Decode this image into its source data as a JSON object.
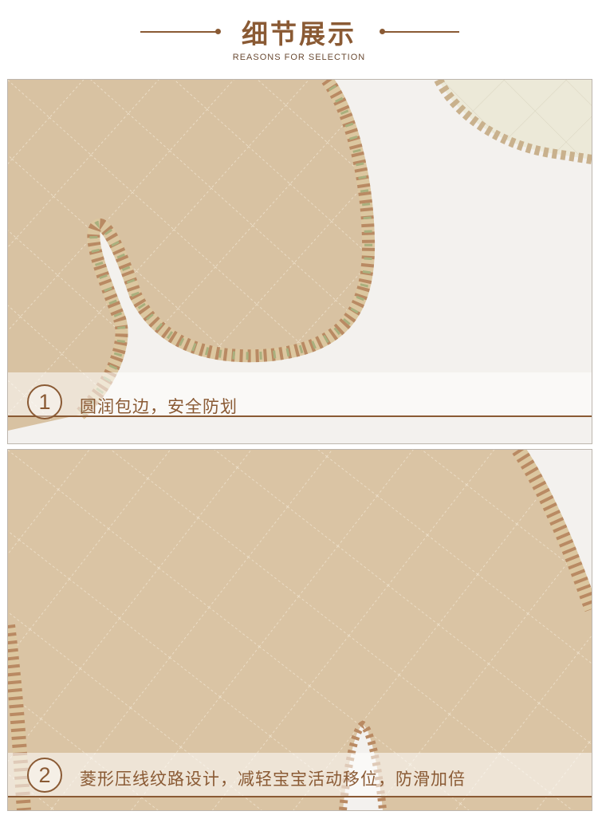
{
  "header": {
    "title": "细节展示",
    "subtitle": "REASONS FOR SELECTION"
  },
  "colors": {
    "accent": "#8a5a34",
    "fabric": "#d9c3a3",
    "stitch": "#efe3cf"
  },
  "features": [
    {
      "number": "1",
      "text": "圆润包边，安全防划"
    },
    {
      "number": "2",
      "text": "菱形压线纹路设计，减轻宝宝活动移位，防滑加倍"
    }
  ]
}
